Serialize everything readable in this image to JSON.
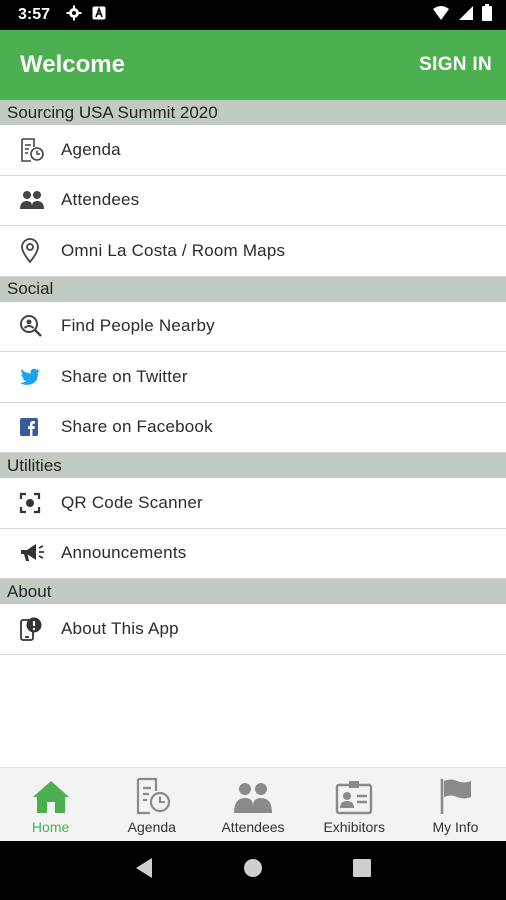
{
  "status_bar": {
    "time": "3:57",
    "icons": [
      "gear-icon",
      "notification-a-icon",
      "wifi-icon",
      "signal-icon",
      "battery-icon"
    ]
  },
  "app_bar": {
    "title": "Welcome",
    "sign_in_label": "SIGN IN",
    "color": "#4caf50"
  },
  "sections": [
    {
      "header": "Sourcing USA Summit 2020",
      "items": [
        {
          "label": "Agenda",
          "icon": "agenda-icon"
        },
        {
          "label": "Attendees",
          "icon": "people-icon"
        },
        {
          "label": "Omni La Costa / Room Maps",
          "icon": "map-pin-icon"
        }
      ]
    },
    {
      "header": "Social",
      "items": [
        {
          "label": "Find People Nearby",
          "icon": "find-people-icon"
        },
        {
          "label": "Share on Twitter",
          "icon": "twitter-icon"
        },
        {
          "label": "Share on Facebook",
          "icon": "facebook-icon"
        }
      ]
    },
    {
      "header": "Utilities",
      "items": [
        {
          "label": "QR Code Scanner",
          "icon": "qr-scanner-icon"
        },
        {
          "label": "Announcements",
          "icon": "megaphone-icon"
        }
      ]
    },
    {
      "header": "About",
      "items": [
        {
          "label": "About This App",
          "icon": "info-icon"
        }
      ]
    }
  ],
  "bottom_nav": {
    "active": "Home",
    "items": [
      {
        "label": "Home",
        "icon": "home-icon"
      },
      {
        "label": "Agenda",
        "icon": "agenda-icon"
      },
      {
        "label": "Attendees",
        "icon": "people-icon"
      },
      {
        "label": "Exhibitors",
        "icon": "exhibitors-icon"
      },
      {
        "label": "My Info",
        "icon": "flag-icon"
      }
    ]
  },
  "colors": {
    "accent": "#4caf50",
    "section_header_bg": "#c2cbc2",
    "twitter": "#1da1f2",
    "facebook": "#3b5998",
    "inactive_icon": "#8a8a8a"
  }
}
